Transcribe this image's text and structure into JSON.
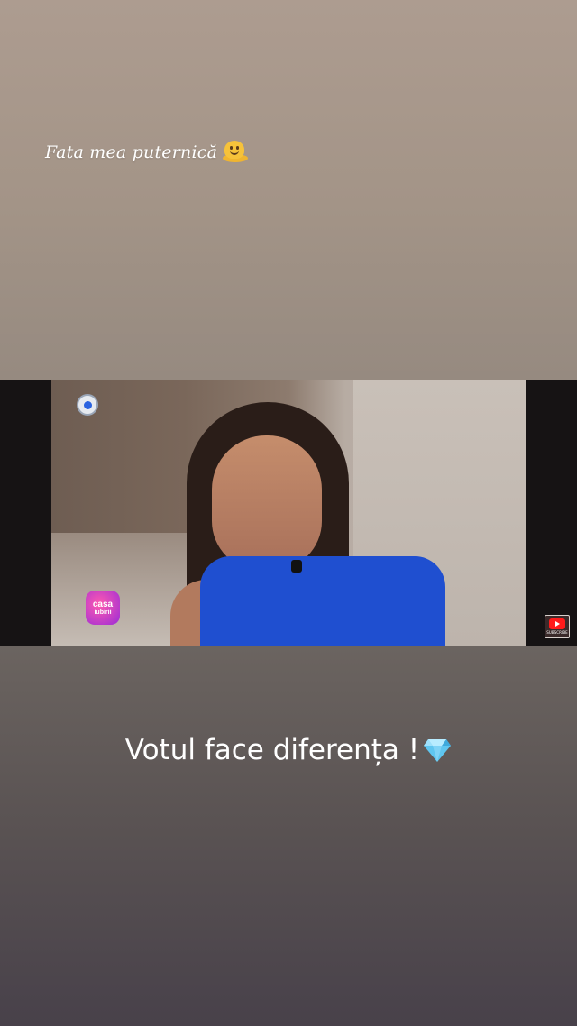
{
  "story": {
    "caption_top": "Fata mea puternică",
    "caption_top_emoji": "melting-face-icon",
    "caption_main": "Votul face diferența !",
    "caption_main_emoji": "gem-stone-icon"
  },
  "video": {
    "channel_logo": "kanal-d-logo",
    "show_logo": {
      "line1": "casa",
      "line2": "iubirii"
    },
    "youtube_badge": {
      "label": "SUBSCRIBE"
    }
  },
  "colors": {
    "top_blue": "#1f4fd0",
    "gem": "#5fc6f0",
    "youtube_red": "#ff1a1a"
  }
}
